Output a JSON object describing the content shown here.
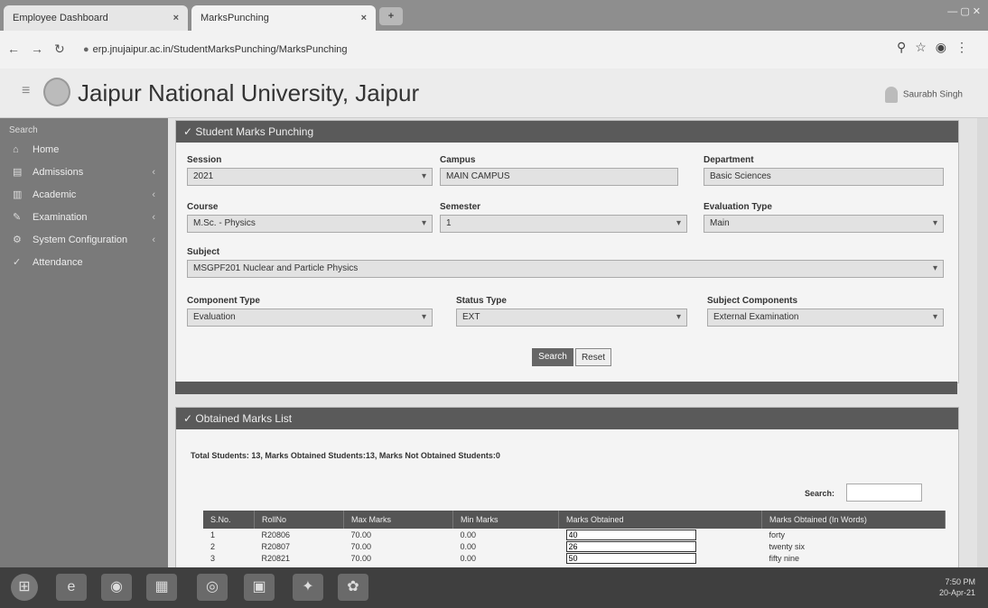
{
  "browser": {
    "tabs": [
      {
        "label": "Employee Dashboard"
      },
      {
        "label": "MarksPunching"
      }
    ],
    "url": "erp.jnujaipur.ac.in/StudentMarksPunching/MarksPunching"
  },
  "header": {
    "title": "Jaipur National University, Jaipur",
    "user": "Saurabh Singh"
  },
  "sidebar": {
    "search": "Search",
    "items": [
      {
        "label": "Home",
        "icon": "home-icon"
      },
      {
        "label": "Admissions",
        "icon": "admissions-icon"
      },
      {
        "label": "Academic",
        "icon": "academic-icon"
      },
      {
        "label": "Examination",
        "icon": "examination-icon"
      },
      {
        "label": "System Configuration",
        "icon": "configuration-icon"
      },
      {
        "label": "Attendance",
        "icon": "attendance-icon"
      }
    ]
  },
  "form": {
    "panel_title": "Student Marks Punching",
    "session_label": "Session",
    "session_value": "2021",
    "campus_label": "Campus",
    "campus_value": "MAIN CAMPUS",
    "department_label": "Department",
    "department_value": "Basic Sciences",
    "course_label": "Course",
    "course_value": "M.Sc. - Physics",
    "semester_label": "Semester",
    "semester_value": "1",
    "evaluation_label": "Evaluation Type",
    "evaluation_value": "Main",
    "subject_label": "Subject",
    "subject_value": "MSGPF201 Nuclear and Particle Physics",
    "component_type_label": "Component Type",
    "component_type_value": "Evaluation",
    "status_type_label": "Status Type",
    "status_type_value": "EXT",
    "subject_components_label": "Subject Components",
    "subject_components_value": "External Examination",
    "search_button": "Search",
    "reset_button": "Reset"
  },
  "marks": {
    "panel_title": "Obtained Marks List",
    "summary": "Total Students: 13,  Marks Obtained Students:13,  Marks Not Obtained Students:0",
    "search_label": "Search:",
    "columns": [
      "S.No.",
      "RollNo",
      "Max Marks",
      "Min Marks",
      "Marks Obtained",
      "Marks Obtained (In Words)"
    ],
    "rows": [
      {
        "sno": "1",
        "roll": "R20806",
        "max": "70.00",
        "min": "0.00",
        "obtained": "40",
        "words": "forty"
      },
      {
        "sno": "2",
        "roll": "R20807",
        "max": "70.00",
        "min": "0.00",
        "obtained": "26",
        "words": "twenty six"
      },
      {
        "sno": "3",
        "roll": "R20821",
        "max": "70.00",
        "min": "0.00",
        "obtained": "50",
        "words": "fifty nine"
      }
    ]
  },
  "taskbar": {
    "time": "7:50 PM",
    "date": "20-Apr-21"
  }
}
